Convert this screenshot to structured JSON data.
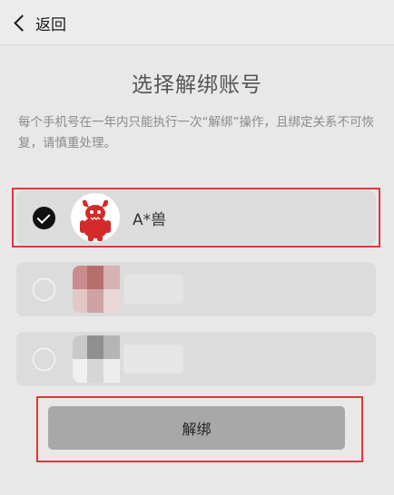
{
  "nav": {
    "back_label": "返回"
  },
  "title": "选择解绑账号",
  "notice": "每个手机号在一年内只能执行一次“解绑”操作，且绑定关系不可恢复，请慎重处理。",
  "accounts": [
    {
      "name": "A*兽",
      "selected": true,
      "avatar_icon": "red-monster-avatar-icon"
    },
    {
      "name": "",
      "selected": false,
      "avatar_icon": "blurred-avatar-icon"
    },
    {
      "name": "",
      "selected": false,
      "avatar_icon": "blurred-avatar-icon"
    }
  ],
  "unbind_button": {
    "label": "解绑"
  },
  "colors": {
    "highlight": "#e5353a",
    "button": "#a8a8a8",
    "avatar_red": "#d42a2a"
  }
}
